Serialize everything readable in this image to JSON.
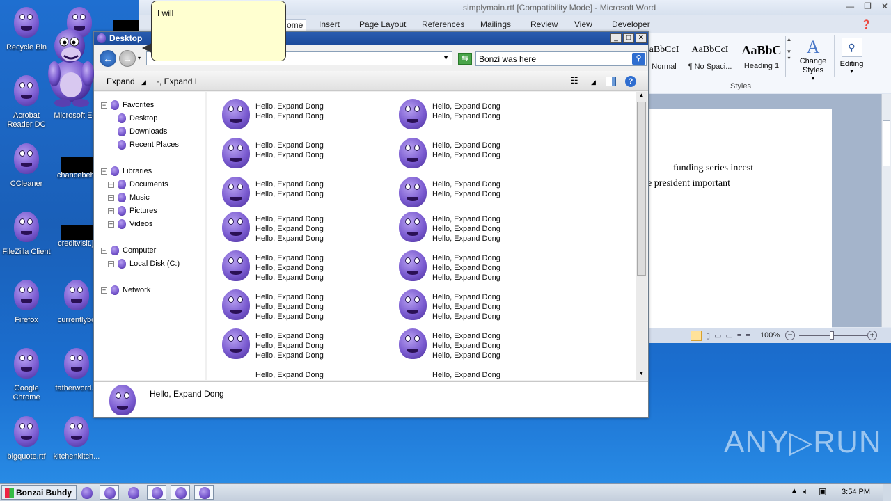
{
  "desktop": {
    "icons": [
      {
        "label": "Recycle Bin"
      },
      {
        "label": "Acrobat Reader DC"
      },
      {
        "label": "Microsoft Ed"
      },
      {
        "label": "CCleaner"
      },
      {
        "label": "chancebehi"
      },
      {
        "label": "FileZilla Client"
      },
      {
        "label": "creditvisit.jj"
      },
      {
        "label": "Firefox"
      },
      {
        "label": "currentlybo"
      },
      {
        "label": "Google Chrome"
      },
      {
        "label": "fatherword..."
      },
      {
        "label": "bigquote.rtf"
      },
      {
        "label": "kitchenkitch..."
      }
    ]
  },
  "word": {
    "title": "simplymain.rtf [Compatibility Mode]  -  Microsoft Word",
    "tabs": [
      "ome",
      "Insert",
      "Page Layout",
      "References",
      "Mailings",
      "Review",
      "View",
      "Developer"
    ],
    "styles": [
      {
        "sample": "aBbCcI",
        "name": "Normal"
      },
      {
        "sample": "AaBbCcI",
        "name": "¶ No Spaci..."
      },
      {
        "sample": "AaBbC",
        "name": "Heading 1"
      }
    ],
    "change_styles": "Change Styles",
    "editing": "Editing",
    "styles_group": "Styles",
    "doc_line1": "funding   series  incest",
    "doc_line2": "e   president        important",
    "zoom": "100%"
  },
  "explorer": {
    "title": "Desktop",
    "search_value": "Bonzi was here",
    "toolbar_expand": "Expand",
    "toolbar_expand2": "·, Expand D",
    "tree": {
      "favorites": "Favorites",
      "desktop": "Desktop",
      "downloads": "Downloads",
      "recent": "Recent Places",
      "libraries": "Libraries",
      "documents": "Documents",
      "music": "Music",
      "pictures": "Pictures",
      "videos": "Videos",
      "computer": "Computer",
      "local_disk": "Local Disk (C:)",
      "network": "Network"
    },
    "file_line": "Hello, Expand Dong",
    "details_text": "Hello, Expand Dong"
  },
  "bubble": {
    "text": "I will"
  },
  "taskbar": {
    "start_label": "Bonzai Buhdy",
    "clock": "3:54 PM"
  },
  "watermark": "ANY▷RUN",
  "colors": {
    "bonzi_purple": "#7a5bd0",
    "explorer_title": "#1b4a9a",
    "bubble_bg": "#ffffd0"
  }
}
